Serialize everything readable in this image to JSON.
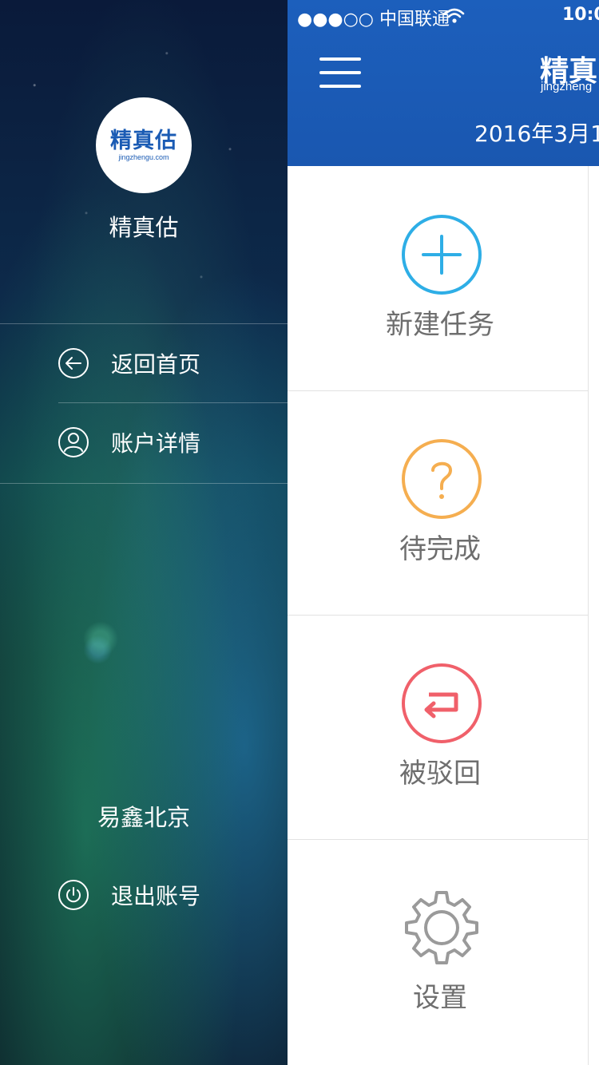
{
  "status_bar": {
    "signal_carrier": "●●●○○ 中国联通",
    "time": "10:0"
  },
  "sidebar": {
    "logo_text": "精真估",
    "logo_subtext": "jingzhengu.com",
    "app_name": "精真估",
    "menu": [
      {
        "label": "返回首页",
        "icon": "back-arrow-circle-icon"
      },
      {
        "label": "账户详情",
        "icon": "user-circle-icon"
      }
    ],
    "user_name": "易鑫北京",
    "logout": {
      "label": "退出账号",
      "icon": "power-icon"
    }
  },
  "header": {
    "brand": "精真",
    "brand_sub": "jingzheng",
    "date": "2016年3月1"
  },
  "tiles": [
    {
      "label": "新建任务",
      "icon": "plus-circle-icon",
      "color": "#2eaee6"
    },
    {
      "label": "待完成",
      "icon": "question-circle-icon",
      "color": "#f5ae50"
    },
    {
      "label": "被驳回",
      "icon": "return-circle-icon",
      "color": "#f0606a"
    },
    {
      "label": "设置",
      "icon": "gear-icon",
      "color": "#9a9a9a"
    }
  ]
}
